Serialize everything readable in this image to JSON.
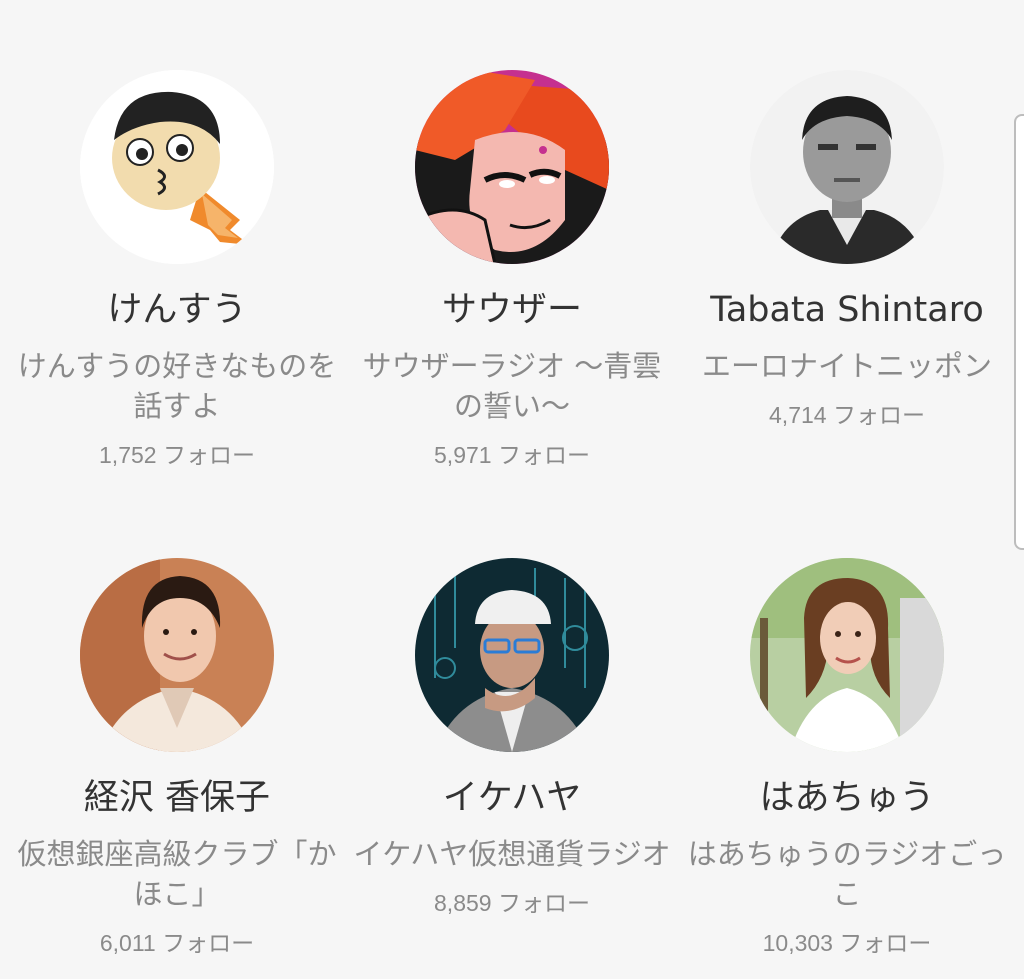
{
  "channels": [
    {
      "name": "けんすう",
      "program": "けんすうの好きなものを話すよ",
      "followers": "1,752 フォロー",
      "avatar": "cartoon-face-avatar"
    },
    {
      "name": "サウザー",
      "program": "サウザーラジオ 〜青雲の誓い〜",
      "followers": "5,971 フォロー",
      "avatar": "manga-character-avatar"
    },
    {
      "name": "Tabata Shintaro",
      "program": "エーロナイトニッポン",
      "followers": "4,714 フォロー",
      "avatar": "man-bw-photo-avatar"
    },
    {
      "name": "経沢 香保子",
      "program": "仮想銀座高級クラブ「かほこ」",
      "followers": "6,011 フォロー",
      "avatar": "woman-kimono-photo-avatar"
    },
    {
      "name": "イケハヤ",
      "program": "イケハヤ仮想通貨ラジオ",
      "followers": "8,859 フォロー",
      "avatar": "man-cap-glasses-avatar"
    },
    {
      "name": "はあちゅう",
      "program": "はあちゅうのラジオごっこ",
      "followers": "10,303 フォロー",
      "avatar": "woman-street-photo-avatar"
    }
  ]
}
